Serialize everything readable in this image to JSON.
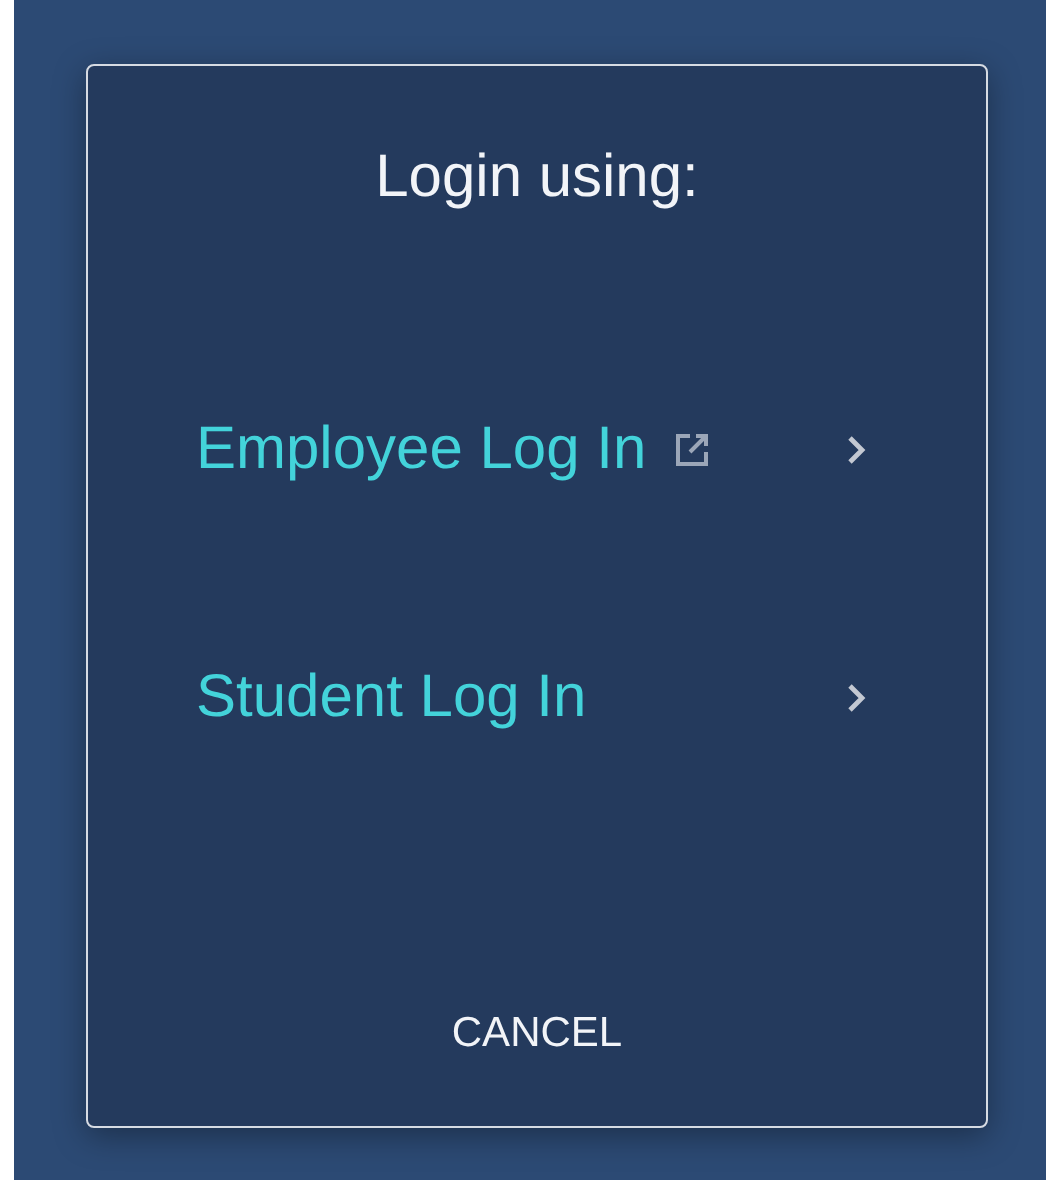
{
  "dialog": {
    "title": "Login using:",
    "options": [
      {
        "label": "Employee Log In",
        "external": true
      },
      {
        "label": "Student Log In",
        "external": false
      }
    ],
    "cancel": "CANCEL"
  }
}
